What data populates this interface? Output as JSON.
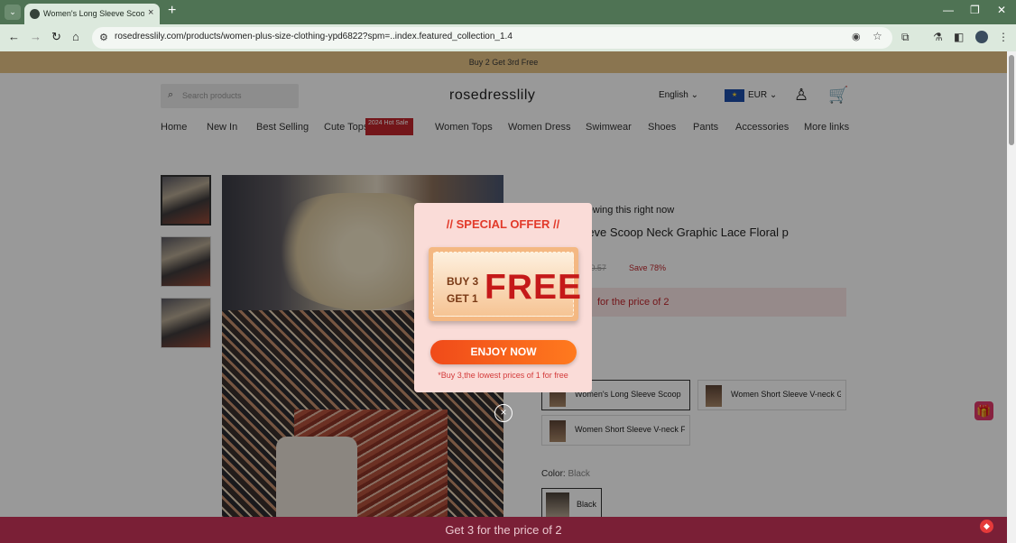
{
  "browser": {
    "tab_list_icon": "chevron-down-icon",
    "tab_title": "Women's Long Sleeve Scoop N",
    "tab_close": "×",
    "new_tab": "+",
    "url": "rosedresslily.com/products/women-plus-size-clothing-ypd6822?spm=..index.featured_collection_1.4",
    "minimize": "—",
    "maximize": "❐",
    "close": "✕"
  },
  "site": {
    "announcement": "Buy 2 Get 3rd Free",
    "search_placeholder": "Search products",
    "logo": "rosedresslily",
    "language": "English",
    "currency": "EUR",
    "menu": [
      "Home",
      "New In",
      "Best Selling",
      "Cute Tops",
      "Women Tops",
      "Women Dress",
      "Swimwear",
      "Shoes",
      "Pants",
      "Accessories",
      "More links"
    ],
    "hot_badge": "2024 Hot Sale"
  },
  "product": {
    "viewing": "ple are viewing this right now",
    "title": "Long Sleeve Scoop Neck Graphic Lace Floral p",
    "old_price": "€110.57",
    "save": "Save 78%",
    "promo": "for the price of 2",
    "variants": [
      "Women's Long Sleeve Scoop",
      "Women Short Sleeve V-neck G",
      "Women Short Sleeve V-neck F"
    ],
    "color_label": "Color:",
    "color_value": "Black",
    "swatch_label": "Black"
  },
  "popup": {
    "heading": "// SPECIAL OFFER //",
    "buy": "BUY 3",
    "get": "GET 1",
    "free": "FREE",
    "cta": "ENJOY NOW",
    "note": "*Buy 3,the lowest prices of 1 for free",
    "close": "×"
  },
  "bottom_bar": "Get 3 for the price of 2",
  "colors": {
    "tab_strip": "#4f7354",
    "toolbar": "#dce9dd",
    "announce": "#8a7550",
    "popup_bg": "#fadcd8",
    "cta": "#f04a1a",
    "bottom_bar": "#7a1f36"
  }
}
